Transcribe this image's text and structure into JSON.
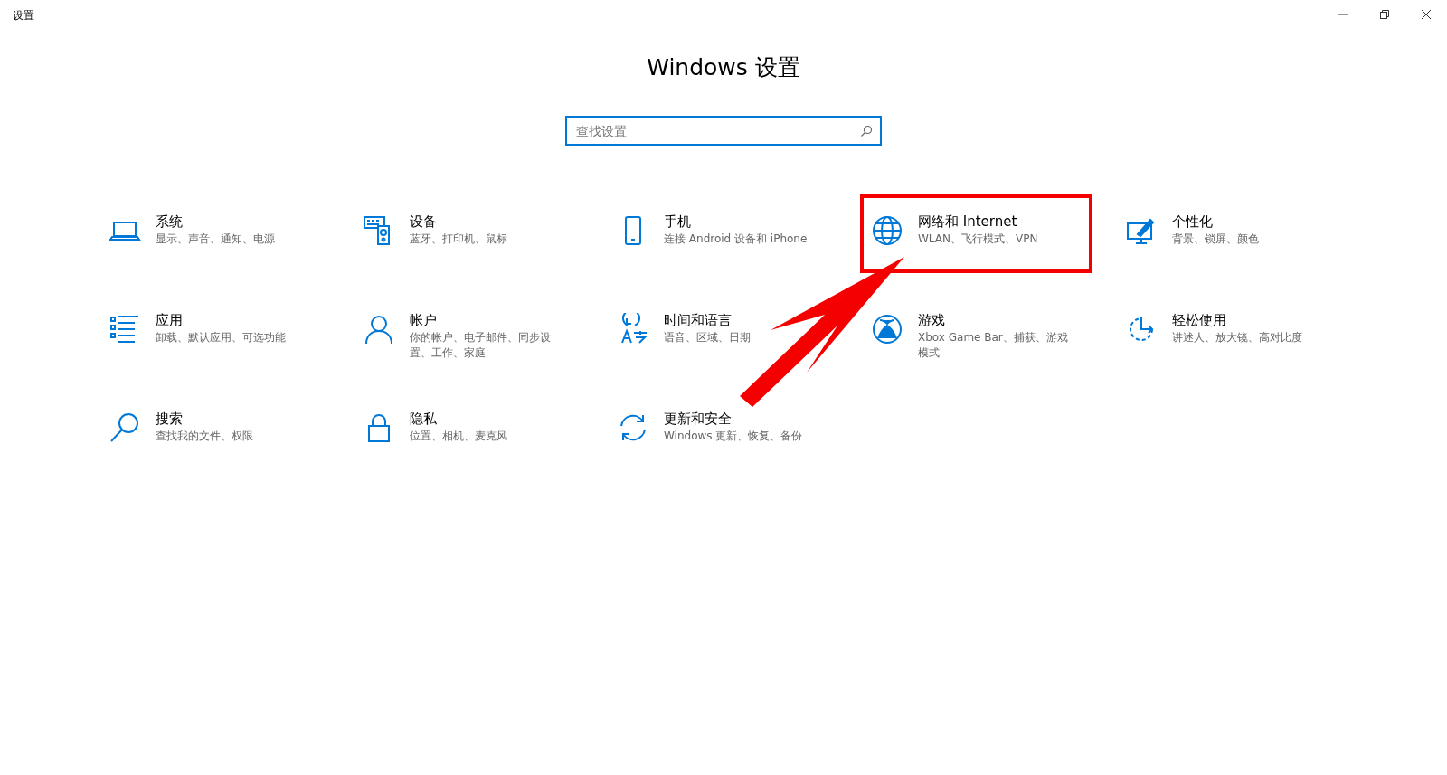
{
  "window": {
    "title": "设置"
  },
  "heading": "Windows 设置",
  "search": {
    "placeholder": "查找设置"
  },
  "items": [
    {
      "title": "系统",
      "description": "显示、声音、通知、电源"
    },
    {
      "title": "设备",
      "description": "蓝牙、打印机、鼠标"
    },
    {
      "title": "手机",
      "description": "连接 Android 设备和 iPhone"
    },
    {
      "title": "网络和 Internet",
      "description": "WLAN、飞行模式、VPN"
    },
    {
      "title": "个性化",
      "description": "背景、锁屏、颜色"
    },
    {
      "title": "应用",
      "description": "卸载、默认应用、可选功能"
    },
    {
      "title": "帐户",
      "description": "你的帐户、电子邮件、同步设置、工作、家庭"
    },
    {
      "title": "时间和语言",
      "description": "语音、区域、日期"
    },
    {
      "title": "游戏",
      "description": "Xbox Game Bar、捕获、游戏模式"
    },
    {
      "title": "轻松使用",
      "description": "讲述人、放大镜、高对比度"
    },
    {
      "title": "搜索",
      "description": "查找我的文件、权限"
    },
    {
      "title": "隐私",
      "description": "位置、相机、麦克风"
    },
    {
      "title": "更新和安全",
      "description": "Windows 更新、恢复、备份"
    }
  ],
  "annotations": {
    "highlight_box": true,
    "arrow": true
  }
}
